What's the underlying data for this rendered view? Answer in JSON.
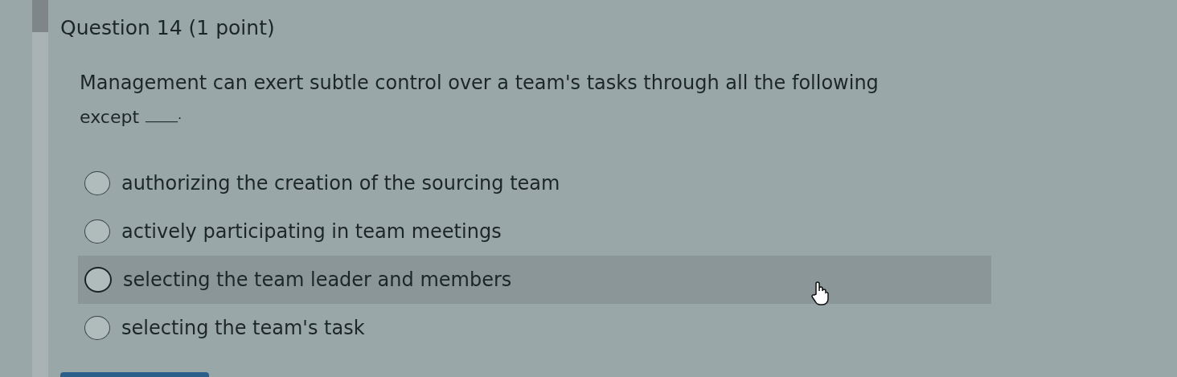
{
  "question": {
    "title": "Question 14",
    "points": "(1 point)",
    "prompt": "Management can exert subtle control over a team's tasks through all the following",
    "prompt_end": "except",
    "blank": "_____."
  },
  "options": [
    {
      "label": "authorizing the creation of the sourcing team",
      "selected": false,
      "hovered": false
    },
    {
      "label": "actively participating in team meetings",
      "selected": false,
      "hovered": false
    },
    {
      "label": "selecting the team leader and members",
      "selected": false,
      "hovered": true
    },
    {
      "label": "selecting the team's task",
      "selected": false,
      "hovered": false
    }
  ]
}
